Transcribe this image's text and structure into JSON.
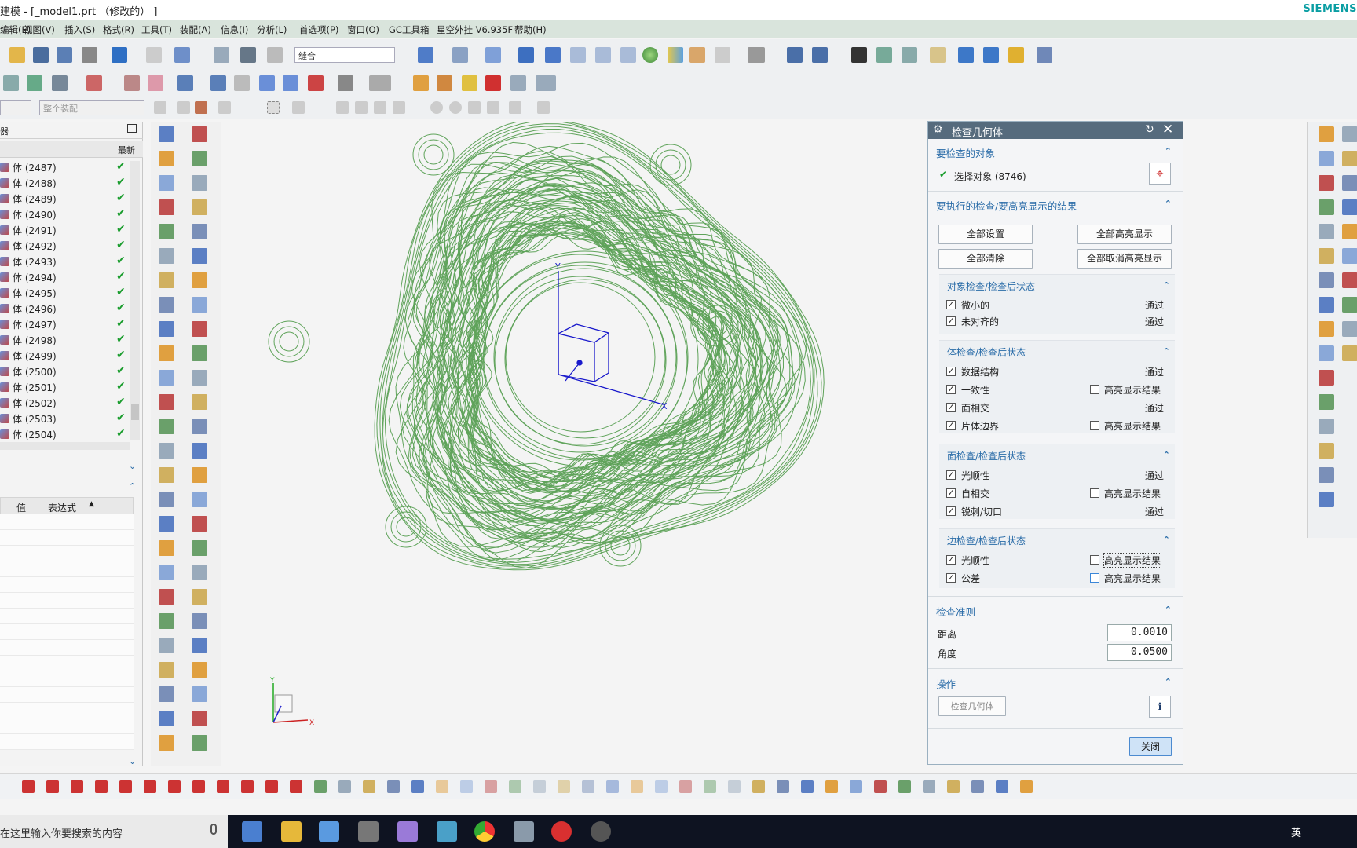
{
  "window": {
    "title": "建模 - [_model1.prt  （修改的）  ]",
    "brand": "SIEMENS"
  },
  "menu": [
    "编辑(E)",
    "视图(V)",
    "插入(S)",
    "格式(R)",
    "工具(T)",
    "装配(A)",
    "信息(I)",
    "分析(L)",
    "首选项(P)",
    "窗口(O)",
    "GC工具箱",
    "星空外挂 V6.935F",
    "帮助(H)"
  ],
  "toolbar": {
    "search_value": "缝合",
    "selection_scope": "整个装配"
  },
  "navigator": {
    "title": "器",
    "column_latest": "最新",
    "rows": [
      {
        "label": "体 (2487)",
        "status": "✔"
      },
      {
        "label": "体 (2488)",
        "status": "✔"
      },
      {
        "label": "体 (2489)",
        "status": "✔"
      },
      {
        "label": "体 (2490)",
        "status": "✔"
      },
      {
        "label": "体 (2491)",
        "status": "✔"
      },
      {
        "label": "体 (2492)",
        "status": "✔"
      },
      {
        "label": "体 (2493)",
        "status": "✔"
      },
      {
        "label": "体 (2494)",
        "status": "✔"
      },
      {
        "label": "体 (2495)",
        "status": "✔"
      },
      {
        "label": "体 (2496)",
        "status": "✔"
      },
      {
        "label": "体 (2497)",
        "status": "✔"
      },
      {
        "label": "体 (2498)",
        "status": "✔"
      },
      {
        "label": "体 (2499)",
        "status": "✔"
      },
      {
        "label": "体 (2500)",
        "status": "✔"
      },
      {
        "label": "体 (2501)",
        "status": "✔"
      },
      {
        "label": "体 (2502)",
        "status": "✔"
      },
      {
        "label": "体 (2503)",
        "status": "✔"
      },
      {
        "label": "体 (2504)",
        "status": "✔"
      }
    ],
    "details_col_value": "值",
    "details_col_expr": "表达式"
  },
  "viewport": {
    "axis_x": "X",
    "axis_y": "Y",
    "triad_x": "X",
    "triad_y": "Y",
    "model_color": "#5fa35a"
  },
  "dialog": {
    "title": "检查几何体",
    "sec_objects": "要检查的对象",
    "select_label": "选择对象 (8746)",
    "sec_checks": "要执行的检查/要高亮显示的结果",
    "btn_set_all": "全部设置",
    "btn_highlight_all": "全部高亮显示",
    "btn_clear_all": "全部清除",
    "btn_unhighlight_all": "全部取消高亮显示",
    "sub_object": "对象检查/检查后状态",
    "item_tiny": "微小的",
    "item_misaligned": "未对齐的",
    "sub_body": "体检查/检查后状态",
    "item_datastruct": "数据结构",
    "item_consistency": "一致性",
    "item_face_intersect": "面相交",
    "item_sheet_boundary": "片体边界",
    "sub_face": "面检查/检查后状态",
    "item_smooth_face": "光顺性",
    "item_self_intersect": "自相交",
    "item_sharp": "锐刺/切口",
    "sub_edge": "边检查/检查后状态",
    "item_smooth_edge": "光顺性",
    "item_tolerance": "公差",
    "pass": "通过",
    "highlight": "高亮显示结果",
    "sec_criteria": "检查准则",
    "distance_label": "距离",
    "distance_value": "0.0010",
    "angle_label": "角度",
    "angle_value": "0.0500",
    "sec_ops": "操作",
    "btn_check": "检查几何体",
    "btn_close": "关闭"
  },
  "taskbar": {
    "search_placeholder": "在这里输入你要搜索的内容",
    "ime": "英"
  }
}
